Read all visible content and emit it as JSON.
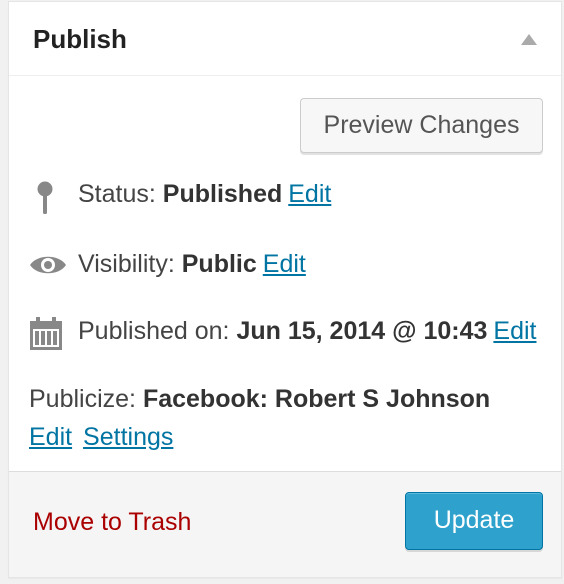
{
  "header": {
    "title": "Publish"
  },
  "preview_button": {
    "label": "Preview Changes"
  },
  "status": {
    "label": "Status:",
    "value": "Published",
    "edit_label": "Edit",
    "icon": "map-pin-icon"
  },
  "visibility": {
    "label": "Visibility:",
    "value": "Public",
    "edit_label": "Edit",
    "icon": "eye-icon"
  },
  "published_on": {
    "label": "Published on:",
    "value": "Jun 15, 2014 @ 10:43",
    "edit_label": "Edit",
    "icon": "calendar-icon"
  },
  "publicize": {
    "label": "Publicize:",
    "value": "Facebook: Robert S Johnson",
    "edit_label": "Edit",
    "settings_label": "Settings"
  },
  "footer": {
    "trash_label": "Move to Trash",
    "update_label": "Update"
  },
  "colors": {
    "link": "#0074a2",
    "trash": "#aa0000",
    "primary_button": "#2ea2cc",
    "icon_gray": "#888888"
  }
}
